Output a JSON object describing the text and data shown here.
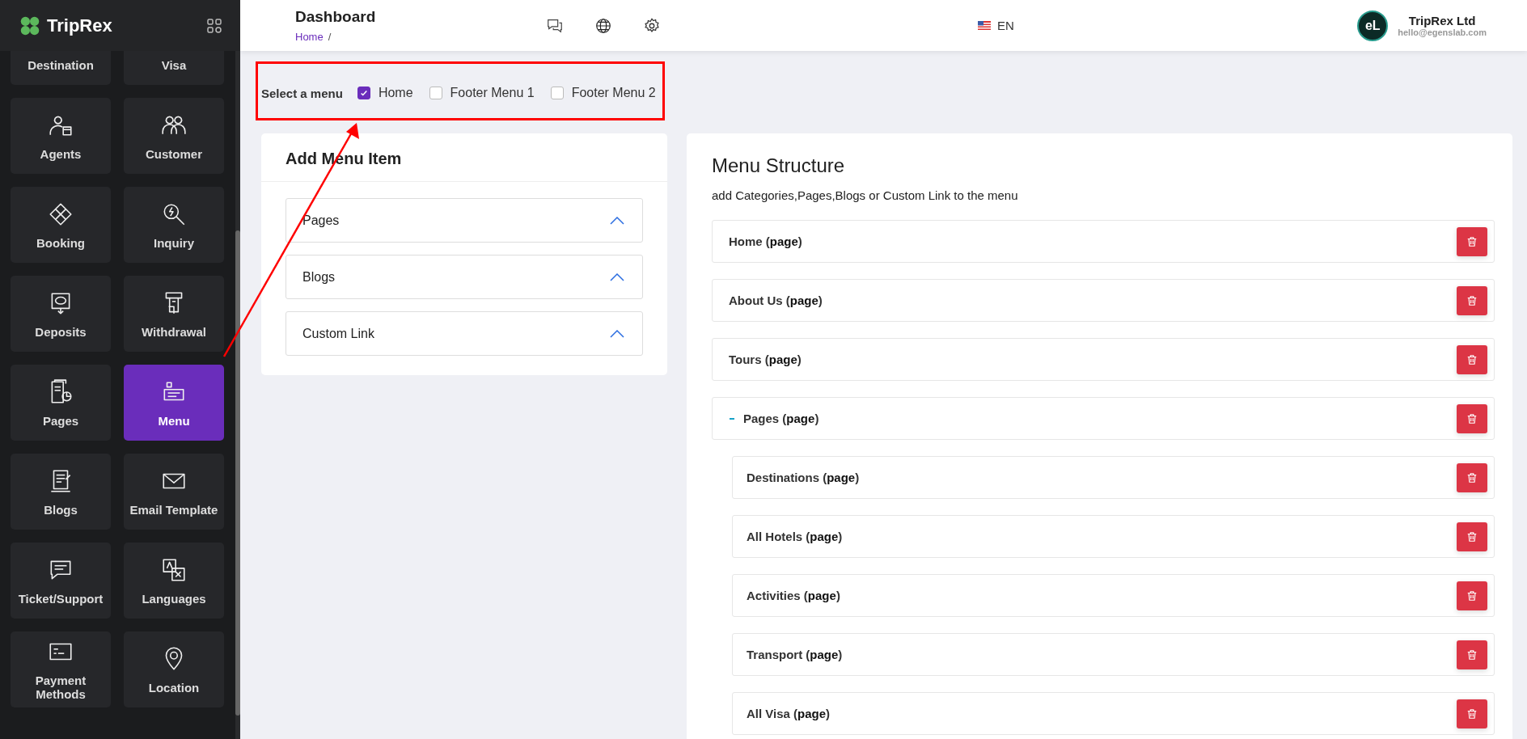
{
  "brand": {
    "name": "TripRex"
  },
  "sidebar": {
    "tiles": [
      {
        "label": "Destination",
        "selected": false
      },
      {
        "label": "Visa",
        "selected": false
      },
      {
        "label": "Agents",
        "selected": false
      },
      {
        "label": "Customer",
        "selected": false
      },
      {
        "label": "Booking",
        "selected": false
      },
      {
        "label": "Inquiry",
        "selected": false
      },
      {
        "label": "Deposits",
        "selected": false
      },
      {
        "label": "Withdrawal",
        "selected": false
      },
      {
        "label": "Pages",
        "selected": false
      },
      {
        "label": "Menu",
        "selected": true
      },
      {
        "label": "Blogs",
        "selected": false
      },
      {
        "label": "Email Template",
        "selected": false
      },
      {
        "label": "Ticket/Support",
        "selected": false
      },
      {
        "label": "Languages",
        "selected": false
      },
      {
        "label": "Payment Methods",
        "selected": false
      },
      {
        "label": "Location",
        "selected": false
      }
    ]
  },
  "header": {
    "title": "Dashboard",
    "breadcrumb": [
      "Home",
      "/"
    ],
    "language": "EN",
    "account": {
      "avatar": "eL",
      "name": "TripRex Ltd",
      "email": "hello@egenslab.com"
    }
  },
  "menu_select": {
    "label": "Select a menu",
    "options": [
      {
        "label": "Home",
        "checked": true
      },
      {
        "label": "Footer Menu 1",
        "checked": false
      },
      {
        "label": "Footer Menu 2",
        "checked": false
      }
    ]
  },
  "add_menu_item": {
    "title": "Add Menu Item",
    "sections": [
      {
        "label": "Pages"
      },
      {
        "label": "Blogs"
      },
      {
        "label": "Custom Link"
      }
    ]
  },
  "menu_structure": {
    "title": "Menu Structure",
    "subtitle": "add Categories,Pages,Blogs or Custom Link to the menu",
    "items": [
      {
        "label": "Home (**page**)"
      },
      {
        "label": "About Us (**page**)"
      },
      {
        "label": "Tours (**page**)"
      },
      {
        "label": "Pages (**page**)",
        "expanded": true,
        "children": [
          {
            "label": "Destinations (**page**)"
          },
          {
            "label": "All Hotels (**page**)"
          },
          {
            "label": "Activities (**page**)"
          },
          {
            "label": "Transport (**page**)"
          },
          {
            "label": "All Visa (**page**)"
          }
        ]
      }
    ]
  }
}
